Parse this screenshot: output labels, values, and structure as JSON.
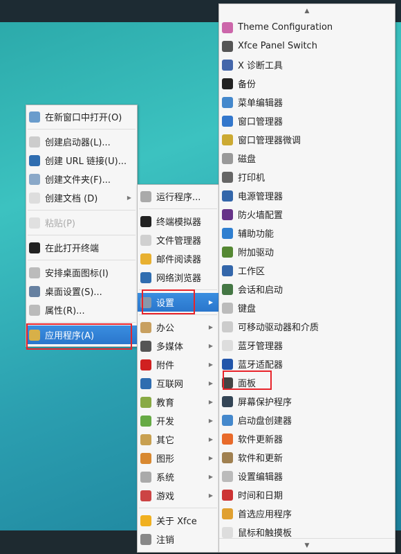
{
  "desktop_menu": {
    "items": [
      {
        "label": "在新窗口中打开(O)",
        "icon": "folder-icon",
        "color": "#6a9ccc"
      },
      {
        "sep": true
      },
      {
        "label": "创建启动器(L)...",
        "icon": "launcher-icon",
        "color": "#cccccc"
      },
      {
        "label": "创建 URL 链接(U)...",
        "icon": "globe-link-icon",
        "color": "#2f6db0"
      },
      {
        "label": "创建文件夹(F)...",
        "icon": "new-folder-icon",
        "color": "#8aa8c8"
      },
      {
        "label": "创建文档 (D)",
        "icon": "new-document-icon",
        "color": "#dddddd",
        "submenu": true
      },
      {
        "sep": true
      },
      {
        "label": "粘贴(P)",
        "icon": "paste-icon",
        "color": "#e0e0e0",
        "disabled": true
      },
      {
        "sep": true
      },
      {
        "label": "在此打开终端",
        "icon": "terminal-icon",
        "color": "#222222"
      },
      {
        "sep": true
      },
      {
        "label": "安排桌面图标(I)",
        "icon": "arrange-icon",
        "color": "#bbbbbb"
      },
      {
        "label": "桌面设置(S)...",
        "icon": "desktop-settings-icon",
        "color": "#6680a0"
      },
      {
        "label": "属性(R)...",
        "icon": "gear-icon",
        "color": "#bbbbbb"
      },
      {
        "sep": true
      },
      {
        "label": "应用程序(A)",
        "icon": "applications-icon",
        "color": "#d8b048",
        "selected": true
      }
    ]
  },
  "apps_menu": {
    "items": [
      {
        "label": "运行程序...",
        "icon": "run-icon",
        "color": "#aaaaaa"
      },
      {
        "sep": true
      },
      {
        "label": "终端模拟器",
        "icon": "terminal-icon",
        "color": "#222222"
      },
      {
        "label": "文件管理器",
        "icon": "folder-icon",
        "color": "#d0d0d0"
      },
      {
        "label": "邮件阅读器",
        "icon": "mail-icon",
        "color": "#e8b030"
      },
      {
        "label": "网络浏览器",
        "icon": "browser-icon",
        "color": "#2f6db0"
      },
      {
        "sep": true
      },
      {
        "label": "设置",
        "icon": "settings-icon",
        "color": "#8899aa",
        "submenu": true,
        "selected": true
      },
      {
        "sep": true
      },
      {
        "label": "办公",
        "icon": "office-icon",
        "color": "#c8a060",
        "submenu": true
      },
      {
        "label": "多媒体",
        "icon": "multimedia-icon",
        "color": "#555555",
        "submenu": true
      },
      {
        "label": "附件",
        "icon": "accessories-icon",
        "color": "#d02020",
        "submenu": true
      },
      {
        "label": "互联网",
        "icon": "internet-icon",
        "color": "#2f6db0",
        "submenu": true
      },
      {
        "label": "教育",
        "icon": "education-icon",
        "color": "#88aa44",
        "submenu": true
      },
      {
        "label": "开发",
        "icon": "development-icon",
        "color": "#66aa44",
        "submenu": true
      },
      {
        "label": "其它",
        "icon": "other-icon",
        "color": "#c8a050",
        "submenu": true
      },
      {
        "label": "图形",
        "icon": "graphics-icon",
        "color": "#d88830",
        "submenu": true
      },
      {
        "label": "系统",
        "icon": "system-icon",
        "color": "#aaaaaa",
        "submenu": true
      },
      {
        "label": "游戏",
        "icon": "games-icon",
        "color": "#cc4444",
        "submenu": true
      },
      {
        "sep": true
      },
      {
        "label": "关于 Xfce",
        "icon": "star-icon",
        "color": "#f0b020"
      },
      {
        "label": "注销",
        "icon": "logout-icon",
        "color": "#888888"
      }
    ]
  },
  "settings_menu": {
    "scroll_up": "▲",
    "scroll_down": "▼",
    "items": [
      {
        "label": "Theme Configuration",
        "icon": "theme-icon",
        "color": "#cc66aa"
      },
      {
        "label": "Xfce Panel Switch",
        "icon": "panel-switch-icon",
        "color": "#555555"
      },
      {
        "label": "X 诊断工具",
        "icon": "diagnostic-icon",
        "color": "#4466aa"
      },
      {
        "label": "备份",
        "icon": "backup-icon",
        "color": "#222222"
      },
      {
        "label": "菜单编辑器",
        "icon": "menu-editor-icon",
        "color": "#4488cc"
      },
      {
        "label": "窗口管理器",
        "icon": "window-manager-icon",
        "color": "#3377cc"
      },
      {
        "label": "窗口管理器微调",
        "icon": "window-tweaks-icon",
        "color": "#ccaa33"
      },
      {
        "label": "磁盘",
        "icon": "disk-icon",
        "color": "#999999"
      },
      {
        "label": "打印机",
        "icon": "printer-icon",
        "color": "#666666"
      },
      {
        "label": "电源管理器",
        "icon": "power-icon",
        "color": "#3366aa"
      },
      {
        "label": "防火墙配置",
        "icon": "firewall-icon",
        "color": "#663388"
      },
      {
        "label": "辅助功能",
        "icon": "accessibility-icon",
        "color": "#2f7fd0"
      },
      {
        "label": "附加驱动",
        "icon": "driver-icon",
        "color": "#558833"
      },
      {
        "label": "工作区",
        "icon": "workspace-icon",
        "color": "#3366aa"
      },
      {
        "label": "会话和启动",
        "icon": "session-icon",
        "color": "#447744"
      },
      {
        "label": "键盘",
        "icon": "keyboard-icon",
        "color": "#bbbbbb"
      },
      {
        "label": "可移动驱动器和介质",
        "icon": "removable-drive-icon",
        "color": "#cccccc"
      },
      {
        "label": "蓝牙管理器",
        "icon": "bluetooth-icon",
        "color": "#dddddd"
      },
      {
        "label": "蓝牙适配器",
        "icon": "bluetooth-adapter-icon",
        "color": "#2255aa"
      },
      {
        "label": "面板",
        "icon": "panel-icon",
        "color": "#444444"
      },
      {
        "label": "屏幕保护程序",
        "icon": "screensaver-icon",
        "color": "#334455"
      },
      {
        "label": "启动盘创建器",
        "icon": "startup-disk-icon",
        "color": "#4488cc"
      },
      {
        "label": "软件更新器",
        "icon": "software-updater-icon",
        "color": "#e86a2a"
      },
      {
        "label": "软件和更新",
        "icon": "software-sources-icon",
        "color": "#a08050"
      },
      {
        "label": "设置编辑器",
        "icon": "settings-editor-icon",
        "color": "#bbbbbb"
      },
      {
        "label": "时间和日期",
        "icon": "clock-icon",
        "color": "#cc3333"
      },
      {
        "label": "首选应用程序",
        "icon": "preferred-apps-icon",
        "color": "#e0a030"
      },
      {
        "label": "鼠标和触摸板",
        "icon": "mouse-icon",
        "color": "#dddddd"
      }
    ]
  }
}
